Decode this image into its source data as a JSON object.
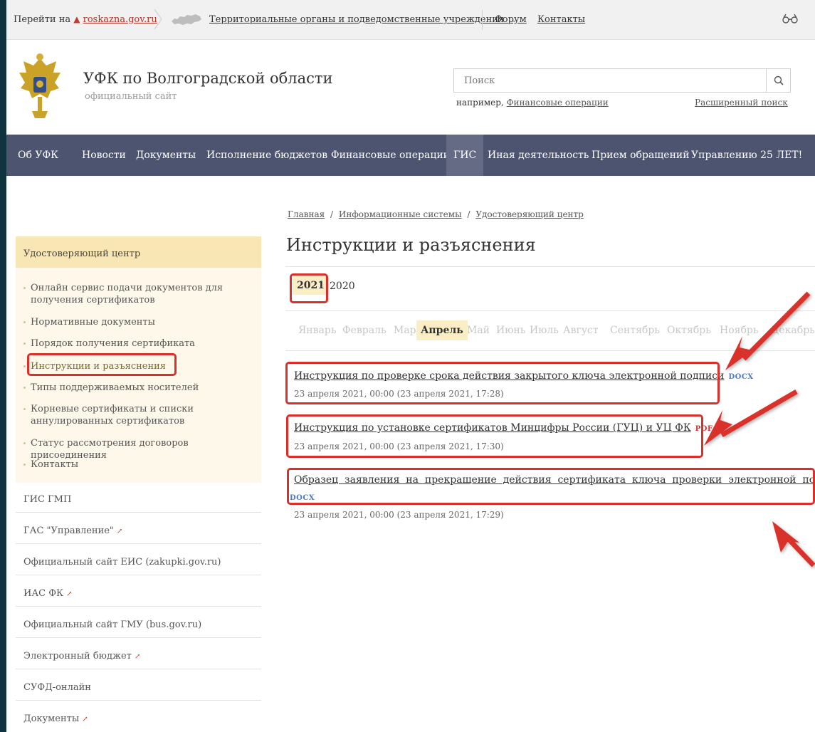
{
  "topbar": {
    "goto_prefix": "Перейти на",
    "goto_link": "roskazna.gov.ru",
    "territorial": "Территориальные органы и подведомственные учреждения",
    "forum": "Форум",
    "contacts": "Контакты"
  },
  "header": {
    "title": "УФК по Волгоградской области",
    "subtitle": "официальный сайт",
    "search_placeholder": "Поиск",
    "example_prefix": "например,",
    "example_link": "Финансовые операции",
    "advanced_search": "Расширенный поиск"
  },
  "nav": {
    "items": [
      {
        "label": "Об УФК"
      },
      {
        "label": "Новости"
      },
      {
        "label": "Документы"
      },
      {
        "label": "Исполнение бюджетов"
      },
      {
        "label": "Финансовые операции"
      },
      {
        "label": "ГИС",
        "active": true
      },
      {
        "label": "Иная деятельность"
      },
      {
        "label": "Прием обращений"
      },
      {
        "label": "Управлению 25 ЛЕТ!"
      }
    ]
  },
  "breadcrumb": {
    "items": [
      "Главная",
      "Информационные системы",
      "Удостоверяющий центр"
    ],
    "separator": "/"
  },
  "page_title": "Инструкции и разъяснения",
  "years": {
    "items": [
      "2021",
      "2020"
    ],
    "active": "2021"
  },
  "months": {
    "items": [
      "Январь",
      "Февраль",
      "Март",
      "Апрель",
      "Май",
      "Июнь",
      "Июль",
      "Август",
      "Сентябрь",
      "Октябрь",
      "Ноябрь",
      "Декабрь"
    ],
    "active": "Апрель"
  },
  "documents": [
    {
      "title": "Инструкция по проверке срока действия закрытого ключа электронной подписи",
      "type": "DOCX",
      "date": "23 апреля 2021, 00:00 (23 апреля 2021, 17:28)"
    },
    {
      "title": "Инструкция по установке сертификатов Минцифры России (ГУЦ) и УЦ ФК",
      "type": "PDF",
      "date": "23 апреля 2021, 00:00 (23 апреля 2021, 17:30)"
    },
    {
      "title_line1": "Образец  заявления  на  прекращение  действия  сертификата  ключа  проверки  электронной  подписи",
      "type": "DOCX",
      "date": "23 апреля 2021, 00:00 (23 апреля 2021, 17:29)"
    }
  ],
  "sidebar": {
    "heading": "Удостоверяющий центр",
    "sub_items": [
      {
        "label": "Онлайн сервис подачи документов для получения сертификатов"
      },
      {
        "label": "Нормативные документы"
      },
      {
        "label": "Порядок получения сертификата"
      },
      {
        "label": "Инструкции и разъяснения",
        "active": true
      },
      {
        "label": "Типы поддерживаемых носителей"
      },
      {
        "label": "Корневые сертификаты и списки аннулированных сертификатов"
      },
      {
        "label": "Статус рассмотрения договоров присоединения"
      },
      {
        "label": "Контакты"
      }
    ],
    "links": [
      {
        "label": "ГИС ГМП"
      },
      {
        "label": "ГАС \"Управление\"",
        "external": true
      },
      {
        "label": "Официальный сайт ЕИС (zakupki.gov.ru)"
      },
      {
        "label": "ИАС ФК",
        "external": true
      },
      {
        "label": "Официальный сайт ГМУ (bus.gov.ru)"
      },
      {
        "label": "Электронный бюджет",
        "external": true
      },
      {
        "label": "СУФД-онлайн"
      },
      {
        "label": "Документы",
        "external": true
      }
    ]
  },
  "colors": {
    "nav_bg": "#4d5470",
    "nav_active": "#656b85",
    "highlight": "#fbeec5",
    "sidebar_head": "#f8e7b4",
    "annotation_red": "#d9302c",
    "slide_bg": "#0f3440"
  },
  "icons": [
    "home-icon",
    "chevron-right-icon",
    "russia-map-icon",
    "chevron-down-icon",
    "glasses-icon",
    "emblem-icon",
    "search-icon",
    "external-link-icon",
    "annotation-arrow-icon"
  ]
}
